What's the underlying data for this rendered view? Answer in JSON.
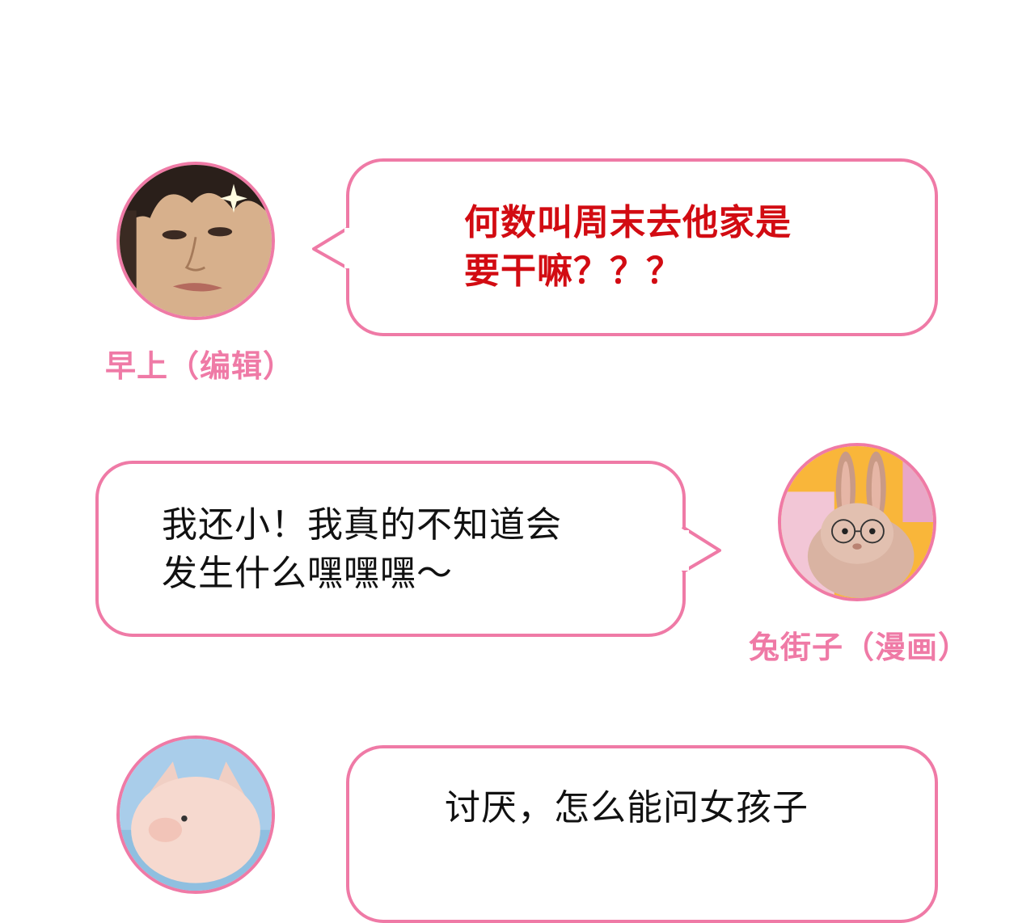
{
  "colors": {
    "accent_pink": "#ef7aa6",
    "highlight_red": "#d20b12",
    "text_black": "#111111"
  },
  "messages": [
    {
      "speaker": "早上（编辑）",
      "text": "何数叫周末去他家是\n要干嘛？？？",
      "text_color": "red",
      "avatar_icon": "man-face-avatar"
    },
    {
      "speaker": "兔街子（漫画）",
      "text": "我还小！我真的不知道会\n发生什么嘿嘿嘿～",
      "text_color": "black",
      "avatar_icon": "rabbit-with-glasses-avatar"
    },
    {
      "text": "讨厌，怎么能问女孩子",
      "text_color": "black",
      "avatar_icon": "pig-avatar"
    }
  ]
}
